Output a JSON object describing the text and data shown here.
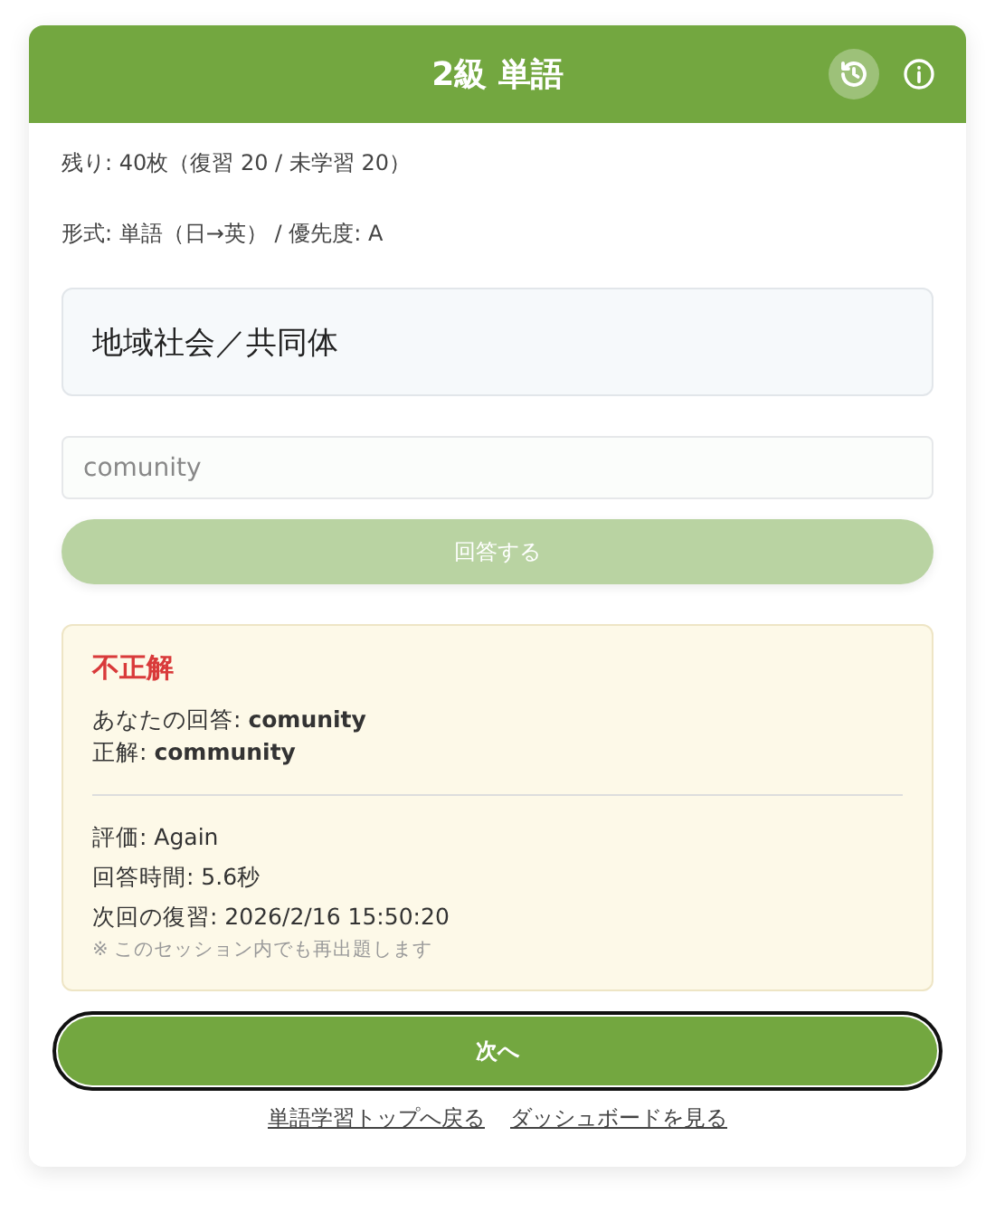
{
  "header": {
    "title": "2級 単語"
  },
  "stats": [
    "残り: 40枚（復習 20 / 未学習 20）",
    "形式: 単語（日→英） / 優先度: A"
  ],
  "prompt": "地域社会／共同体",
  "answer_field": {
    "value": "comunity",
    "disabled": true
  },
  "submit_button": {
    "label": "回答する",
    "disabled": true
  },
  "result": {
    "kind": "incorrect",
    "title": "不正解",
    "answers": [
      "あなたの回答: **comunity**",
      "正解: **community**"
    ],
    "details": [
      "評価: Again",
      "回答時間: 5.6秒",
      "次回の復習: 2026/2/16 15:50:20"
    ],
    "note": "※ このセッション内でも再出題します"
  },
  "next_button": {
    "label": "次へ",
    "focused": true
  },
  "links": [
    "単語学習トップへ戻る",
    "ダッシュボードを見る"
  ]
}
